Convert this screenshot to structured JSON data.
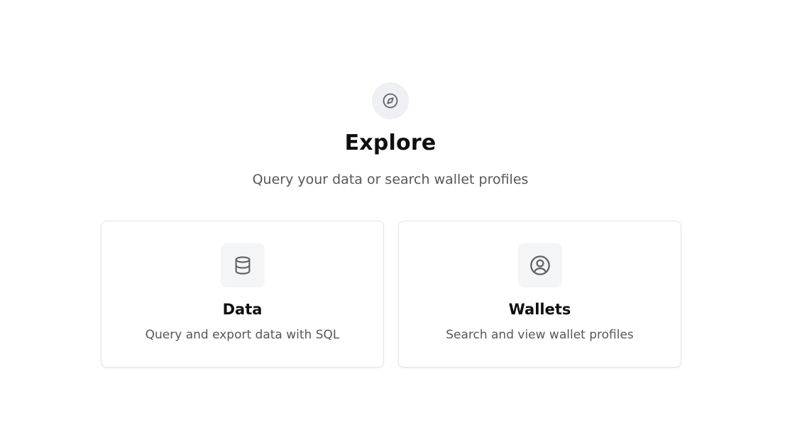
{
  "hero": {
    "icon": "compass-icon",
    "title": "Explore",
    "subtitle": "Query your data or search wallet profiles"
  },
  "cards": [
    {
      "icon": "database-icon",
      "title": "Data",
      "description": "Query and export data with SQL"
    },
    {
      "icon": "user-circle-icon",
      "title": "Wallets",
      "description": "Search and view wallet profiles"
    }
  ],
  "colors": {
    "title": "#0f0f10",
    "muted_text": "#55575c",
    "icon_stroke": "#5f6368",
    "card_border": "#e2e4e8",
    "hero_icon_bg": "#eef0f3",
    "card_icon_bg": "#f4f5f7"
  }
}
